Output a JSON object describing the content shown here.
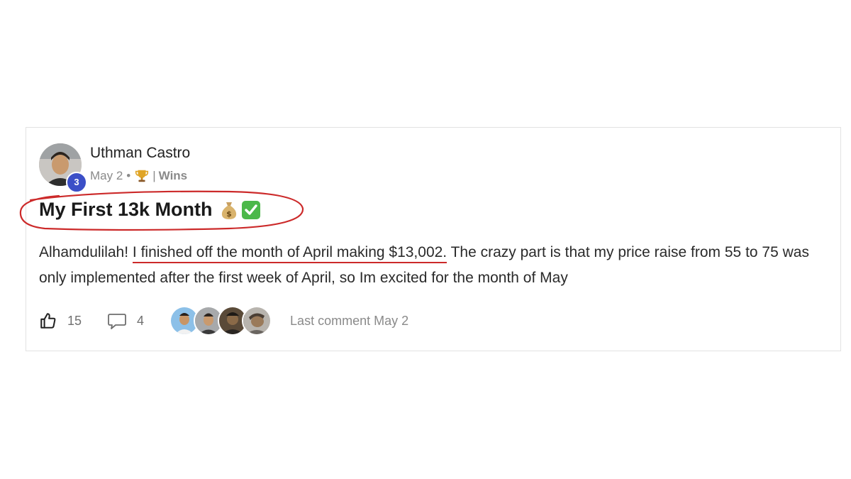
{
  "post": {
    "author": {
      "name": "Uthman Castro",
      "level": "3"
    },
    "meta": {
      "date": "May 2",
      "separator": "•",
      "divider": "|",
      "category": "Wins",
      "badge_icon": "trophy-icon"
    },
    "title": "My First 13k Month",
    "title_emojis": [
      "💰",
      "✅"
    ],
    "body": {
      "before": "Alhamdulilah! ",
      "highlight": "I finished off the month of April making $13,002.",
      "after": " The crazy part is that my price raise from 55 to 75 was only implemented after the first week of April, so Im excited for the month of May"
    },
    "actions": {
      "like_icon": "thumbs-up-icon",
      "like_count": "15",
      "comment_icon": "comment-bubble-icon",
      "comment_count": "4",
      "commenter_avatars": 4,
      "last_comment": "Last comment May 2"
    }
  },
  "annotation_color": "#cc2a2a",
  "badge_color": "#3b4fc7"
}
